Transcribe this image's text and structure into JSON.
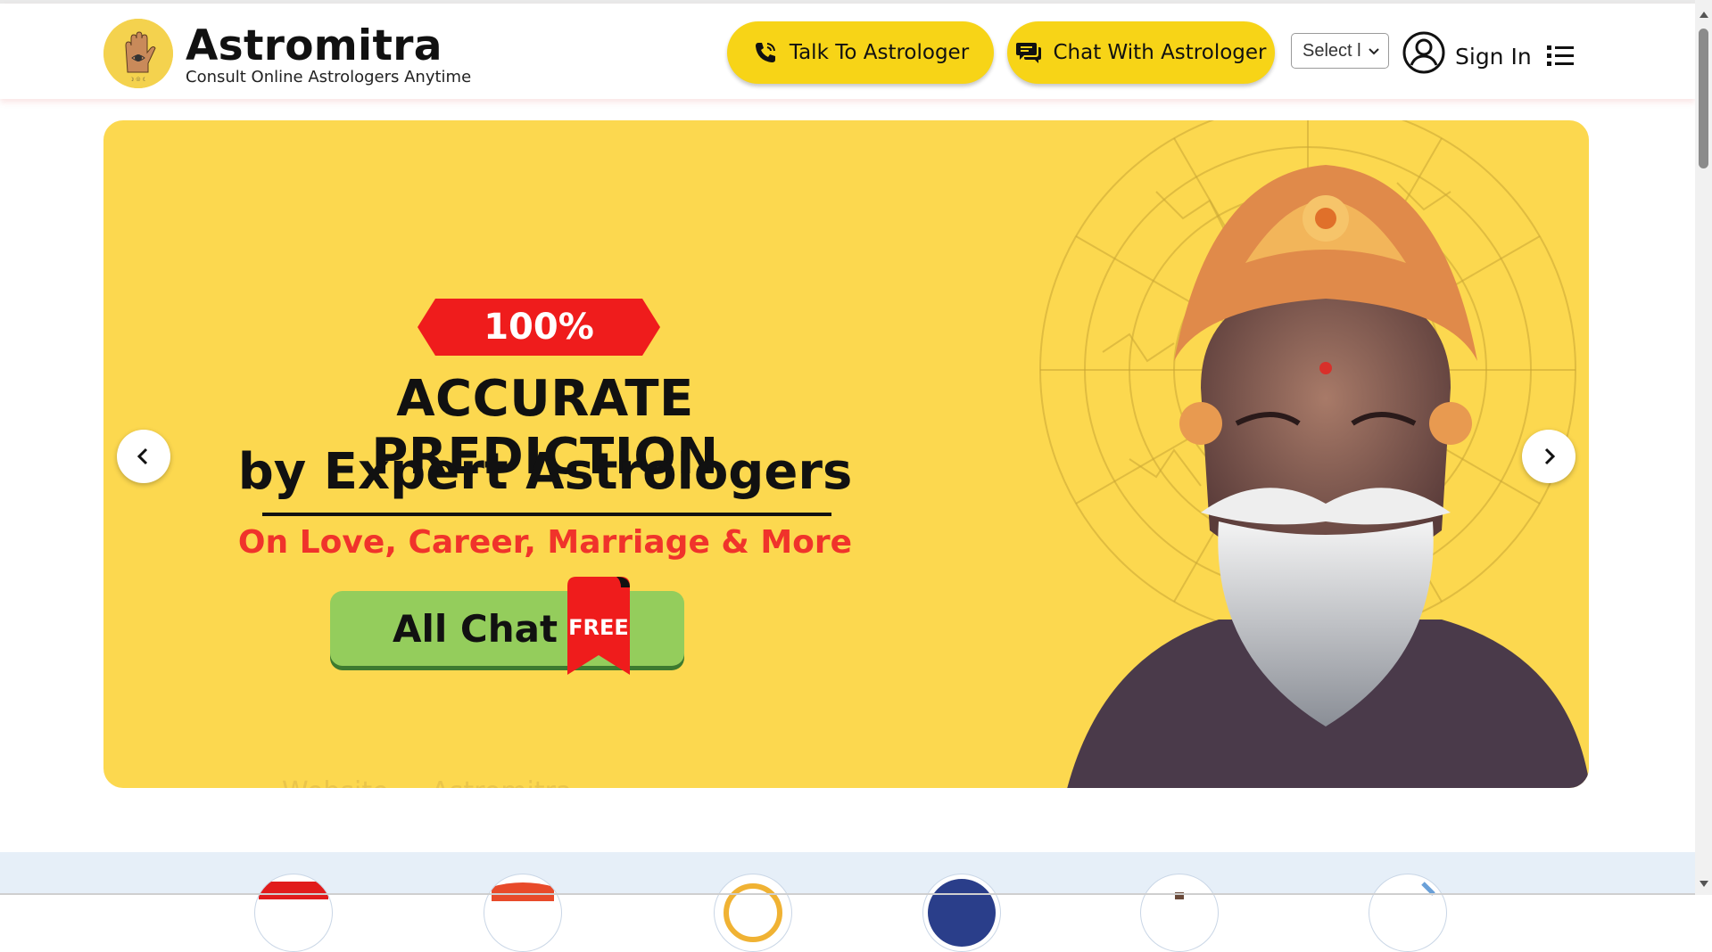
{
  "brand": {
    "name": "Astromitra",
    "tagline": "Consult Online Astrologers Anytime"
  },
  "header": {
    "talk_button": "Talk To Astrologer",
    "chat_button": "Chat With Astrologer",
    "language_select": "Select l",
    "sign_in": "Sign In"
  },
  "banner": {
    "badge": "100%",
    "headline_line1": "ACCURATE PREDICTION",
    "headline_line2": "by Expert Astrologers",
    "subline": "On Love, Career, Marriage & More",
    "cta_label": "All Chat",
    "cta_ribbon": "FREE",
    "faint_text": "Website ... Astromitra"
  },
  "icons": {
    "logo": "palm-logo-icon",
    "talk": "phone-icon",
    "chat": "chat-bubble-icon",
    "user": "user-circle-icon",
    "menu": "list-menu-icon",
    "prev": "chevron-left-icon",
    "next": "chevron-right-icon"
  },
  "colors": {
    "accent_yellow": "#f7d417",
    "banner_bg": "#fcd84f",
    "badge_red": "#ef1c1c",
    "subline_red": "#f0332b",
    "cta_green": "#94cd5c",
    "strip_blue": "#e6eff8"
  }
}
